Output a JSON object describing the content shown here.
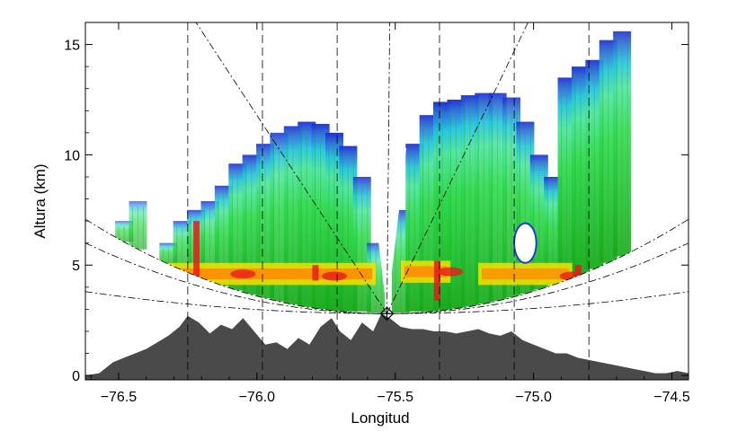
{
  "chart_data": {
    "type": "area",
    "xlabel": "Longitud",
    "ylabel": "Altura (km)",
    "xlim": [
      -76.62,
      -74.44
    ],
    "ylim": [
      -0.2,
      16.0
    ],
    "x_ticks": [
      {
        "value": -76.5,
        "label": "−76.5"
      },
      {
        "value": -76.0,
        "label": "−76.0"
      },
      {
        "value": -75.5,
        "label": "−75.5"
      },
      {
        "value": -75.0,
        "label": "−75.0"
      },
      {
        "value": -74.5,
        "label": "−74.5"
      }
    ],
    "y_ticks": [
      {
        "value": 0,
        "label": "0"
      },
      {
        "value": 5,
        "label": "5"
      },
      {
        "value": 10,
        "label": "10"
      },
      {
        "value": 15,
        "label": "15"
      }
    ],
    "radar_site": {
      "lon": -75.53,
      "alt": 2.8
    },
    "range_rings": [
      {
        "name": "inner",
        "edge_alt": 3.8
      },
      {
        "name": "outer",
        "edge_alt": 6.0
      }
    ],
    "vertical_lines_lon": [
      -76.25,
      -75.98,
      -75.71,
      -75.34,
      -75.07,
      -74.8
    ],
    "elevation_ray_tops": [
      {
        "lon": -76.22,
        "alt": 16.0
      },
      {
        "lon": -75.52,
        "alt": 16.0
      },
      {
        "lon": -75.02,
        "alt": 16.0
      }
    ],
    "terrain": {
      "lon": [
        -76.62,
        -76.57,
        -76.52,
        -76.48,
        -76.44,
        -76.4,
        -76.36,
        -76.32,
        -76.28,
        -76.25,
        -76.21,
        -76.17,
        -76.13,
        -76.09,
        -76.05,
        -76.01,
        -75.97,
        -75.93,
        -75.89,
        -75.85,
        -75.81,
        -75.77,
        -75.73,
        -75.7,
        -75.66,
        -75.62,
        -75.58,
        -75.55,
        -75.52,
        -75.48,
        -75.44,
        -75.4,
        -75.36,
        -75.32,
        -75.28,
        -75.24,
        -75.2,
        -75.16,
        -75.12,
        -75.08,
        -75.04,
        -75.0,
        -74.96,
        -74.92,
        -74.88,
        -74.84,
        -74.8,
        -74.76,
        -74.72,
        -74.68,
        -74.64,
        -74.6,
        -74.56,
        -74.52,
        -74.48,
        -74.44
      ],
      "alt": [
        0.0,
        0.1,
        0.6,
        0.8,
        1.0,
        1.2,
        1.5,
        1.8,
        2.2,
        2.7,
        2.4,
        1.9,
        2.3,
        2.1,
        2.6,
        2.0,
        1.4,
        1.5,
        1.2,
        1.7,
        1.4,
        2.2,
        2.6,
        2.0,
        1.6,
        2.4,
        2.0,
        2.8,
        2.6,
        2.2,
        2.1,
        2.1,
        2.0,
        2.0,
        1.9,
        2.0,
        2.1,
        1.9,
        1.8,
        2.0,
        1.6,
        1.4,
        1.2,
        1.0,
        1.0,
        0.8,
        0.7,
        0.6,
        0.5,
        0.4,
        0.3,
        0.2,
        0.1,
        0.1,
        0.2,
        0.1
      ]
    },
    "reflectivity_columns": [
      {
        "lon": -76.57,
        "base": 3.7,
        "top": 6.2,
        "strength": 0.35
      },
      {
        "lon": -76.53,
        "base": 3.6,
        "top": 6.0,
        "strength": 0.3
      },
      {
        "lon": -76.48,
        "base": 3.5,
        "top": 7.0,
        "strength": 0.25
      },
      {
        "lon": -76.43,
        "base": 3.4,
        "top": 7.9,
        "strength": 0.2
      },
      {
        "lon": -76.37,
        "base": 3.3,
        "top": 4.8,
        "strength": 0.3
      },
      {
        "lon": -76.32,
        "base": 3.3,
        "top": 6.0,
        "strength": 0.45
      },
      {
        "lon": -76.27,
        "base": 3.2,
        "top": 7.0,
        "strength": 0.5
      },
      {
        "lon": -76.22,
        "base": 3.1,
        "top": 7.5,
        "strength": 0.6
      },
      {
        "lon": -76.17,
        "base": 3.1,
        "top": 7.9,
        "strength": 0.6
      },
      {
        "lon": -76.12,
        "base": 3.0,
        "top": 8.6,
        "strength": 0.7
      },
      {
        "lon": -76.07,
        "base": 3.0,
        "top": 9.6,
        "strength": 0.75
      },
      {
        "lon": -76.02,
        "base": 3.0,
        "top": 10.0,
        "strength": 0.8
      },
      {
        "lon": -75.97,
        "base": 2.9,
        "top": 10.5,
        "strength": 0.75
      },
      {
        "lon": -75.92,
        "base": 2.9,
        "top": 11.0,
        "strength": 0.7
      },
      {
        "lon": -75.87,
        "base": 2.9,
        "top": 11.3,
        "strength": 0.8
      },
      {
        "lon": -75.82,
        "base": 2.9,
        "top": 11.5,
        "strength": 0.85
      },
      {
        "lon": -75.77,
        "base": 2.9,
        "top": 11.4,
        "strength": 0.9
      },
      {
        "lon": -75.72,
        "base": 2.9,
        "top": 11.0,
        "strength": 0.95
      },
      {
        "lon": -75.67,
        "base": 2.9,
        "top": 10.4,
        "strength": 0.9
      },
      {
        "lon": -75.62,
        "base": 2.9,
        "top": 9.0,
        "strength": 0.7
      },
      {
        "lon": -75.57,
        "base": 2.85,
        "top": 6.0,
        "strength": 0.5
      },
      {
        "lon": -75.48,
        "base": 2.85,
        "top": 7.5,
        "strength": 0.6
      },
      {
        "lon": -75.43,
        "base": 2.9,
        "top": 10.5,
        "strength": 0.85
      },
      {
        "lon": -75.38,
        "base": 2.9,
        "top": 11.8,
        "strength": 0.85
      },
      {
        "lon": -75.33,
        "base": 2.9,
        "top": 12.4,
        "strength": 0.95
      },
      {
        "lon": -75.28,
        "base": 2.9,
        "top": 12.5,
        "strength": 0.9
      },
      {
        "lon": -75.23,
        "base": 2.9,
        "top": 12.7,
        "strength": 0.85
      },
      {
        "lon": -75.18,
        "base": 2.95,
        "top": 12.8,
        "strength": 0.8
      },
      {
        "lon": -75.13,
        "base": 3.0,
        "top": 12.8,
        "strength": 0.75
      },
      {
        "lon": -75.08,
        "base": 3.0,
        "top": 12.6,
        "strength": 0.7
      },
      {
        "lon": -75.03,
        "base": 3.1,
        "top": 11.5,
        "strength": 0.75
      },
      {
        "lon": -74.98,
        "base": 3.1,
        "top": 10.0,
        "strength": 0.8
      },
      {
        "lon": -74.93,
        "base": 3.2,
        "top": 9.0,
        "strength": 0.8
      },
      {
        "lon": -74.88,
        "base": 3.3,
        "top": 13.5,
        "strength": 0.85
      },
      {
        "lon": -74.83,
        "base": 3.3,
        "top": 14.0,
        "strength": 0.9
      },
      {
        "lon": -74.78,
        "base": 3.4,
        "top": 14.3,
        "strength": 0.85
      },
      {
        "lon": -74.73,
        "base": 3.5,
        "top": 15.2,
        "strength": 0.8
      },
      {
        "lon": -74.68,
        "base": 3.6,
        "top": 15.6,
        "strength": 0.75
      },
      {
        "lon": -74.53,
        "base": 4.0,
        "top": 5.2,
        "strength": 0.3
      }
    ],
    "echo_hole": {
      "lon": -75.03,
      "alt": 6.0,
      "half_width_lon": 0.04,
      "half_height_alt": 0.9
    },
    "colors": {
      "terrain": "#4a4a4a",
      "weak": "#1fb400",
      "moderate": "#2fd86a",
      "light": "#6ff0c8",
      "cyan": "#19c8e0",
      "top": "#1a3fd6",
      "bright_band_yellow": "#f4e000",
      "bright_band_orange": "#ff8c00",
      "bright_band_red": "#e81a1a"
    }
  }
}
